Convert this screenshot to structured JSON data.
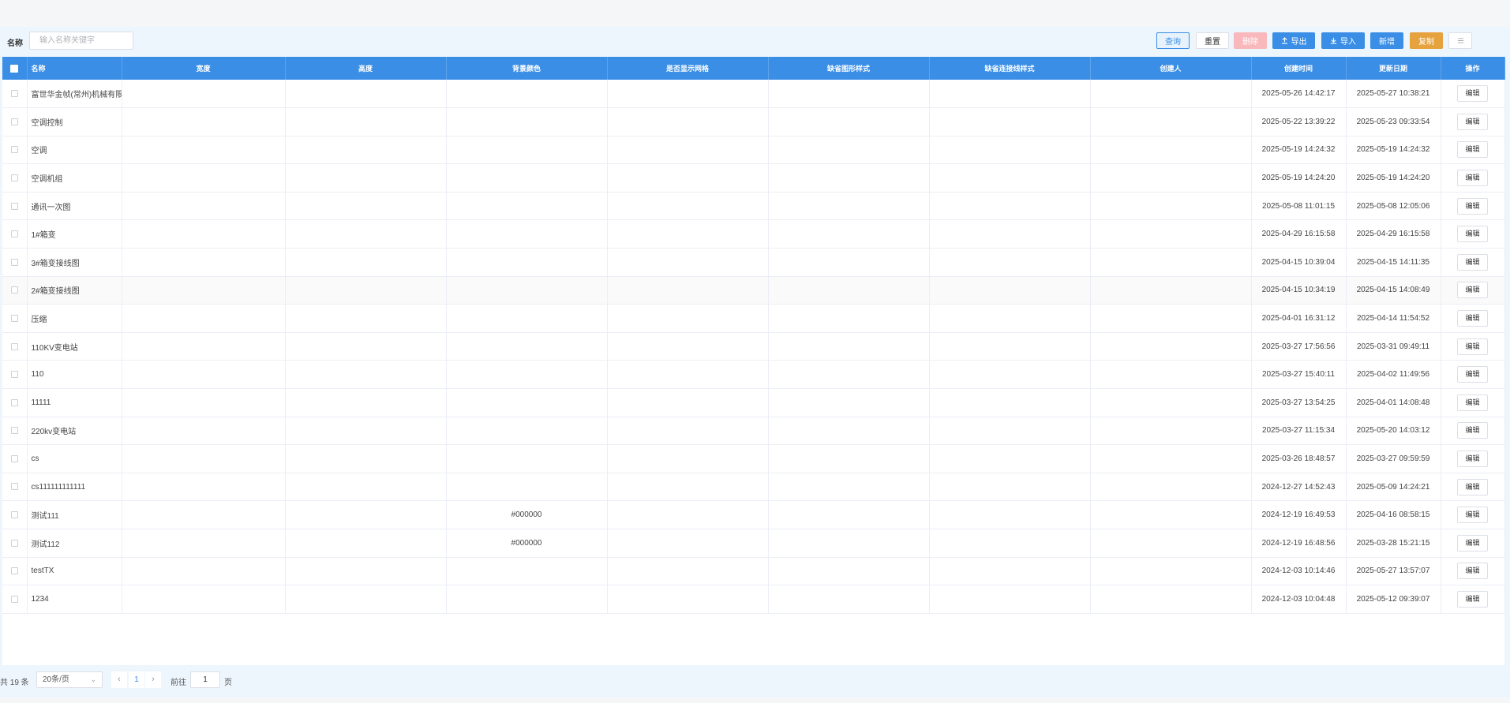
{
  "filter": {
    "label": "名称",
    "placeholder": "输入名称关键字",
    "value": ""
  },
  "toolbar": {
    "query": "查询",
    "reset": "重置",
    "delete": "删除",
    "export": "导出",
    "import": "导入",
    "add": "新增",
    "copy": "复制"
  },
  "icons": {
    "export": "upload-icon",
    "import": "download-icon",
    "columns": "columns-icon",
    "prev": "chevron-left-icon",
    "next": "chevron-right-icon",
    "select": "chevron-down-icon"
  },
  "colors": {
    "primary": "#3a8ee6",
    "danger_light": "#f8b8bc",
    "warning": "#e6a23c"
  },
  "table": {
    "columns": [
      "名称",
      "宽度",
      "高度",
      "背景颜色",
      "是否显示网格",
      "缺省图形样式",
      "缺省连接线样式",
      "创建人",
      "创建时间",
      "更新日期",
      "操作"
    ],
    "edit_label": "编辑",
    "rows": [
      {
        "name": "富世华金帧(常州)机械有限公",
        "bg": "",
        "created": "2025-05-26 14:42:17",
        "updated": "2025-05-27 10:38:21"
      },
      {
        "name": "空调控制",
        "bg": "",
        "created": "2025-05-22 13:39:22",
        "updated": "2025-05-23 09:33:54"
      },
      {
        "name": "空调",
        "bg": "",
        "created": "2025-05-19 14:24:32",
        "updated": "2025-05-19 14:24:32"
      },
      {
        "name": "空调机组",
        "bg": "",
        "created": "2025-05-19 14:24:20",
        "updated": "2025-05-19 14:24:20"
      },
      {
        "name": "通讯一次图",
        "bg": "",
        "created": "2025-05-08 11:01:15",
        "updated": "2025-05-08 12:05:06"
      },
      {
        "name": "1#箱变",
        "bg": "",
        "created": "2025-04-29 16:15:58",
        "updated": "2025-04-29 16:15:58"
      },
      {
        "name": "3#箱变接线图",
        "bg": "",
        "created": "2025-04-15 10:39:04",
        "updated": "2025-04-15 14:11:35"
      },
      {
        "name": "2#箱变接线图",
        "bg": "",
        "created": "2025-04-15 10:34:19",
        "updated": "2025-04-15 14:08:49"
      },
      {
        "name": "压缩",
        "bg": "",
        "created": "2025-04-01 16:31:12",
        "updated": "2025-04-14 11:54:52"
      },
      {
        "name": "110KV变电站",
        "bg": "",
        "created": "2025-03-27 17:56:56",
        "updated": "2025-03-31 09:49:11"
      },
      {
        "name": "110",
        "bg": "",
        "created": "2025-03-27 15:40:11",
        "updated": "2025-04-02 11:49:56"
      },
      {
        "name": "11111",
        "bg": "",
        "created": "2025-03-27 13:54:25",
        "updated": "2025-04-01 14:08:48"
      },
      {
        "name": "220kv变电站",
        "bg": "",
        "created": "2025-03-27 11:15:34",
        "updated": "2025-05-20 14:03:12"
      },
      {
        "name": "cs",
        "bg": "",
        "created": "2025-03-26 18:48:57",
        "updated": "2025-03-27 09:59:59"
      },
      {
        "name": "cs111111111111",
        "bg": "",
        "created": "2024-12-27 14:52:43",
        "updated": "2025-05-09 14:24:21"
      },
      {
        "name": "测试111",
        "bg": "#000000",
        "created": "2024-12-19 16:49:53",
        "updated": "2025-04-16 08:58:15"
      },
      {
        "name": "测试112",
        "bg": "#000000",
        "created": "2024-12-19 16:48:56",
        "updated": "2025-03-28 15:21:15"
      },
      {
        "name": "testTX",
        "bg": "",
        "created": "2024-12-03 10:14:46",
        "updated": "2025-05-27 13:57:07"
      },
      {
        "name": "1234",
        "bg": "",
        "created": "2024-12-03 10:04:48",
        "updated": "2025-05-12 09:39:07"
      }
    ]
  },
  "pagination": {
    "total_text": "共 19 条",
    "page_size": "20条/页",
    "current_page": "1",
    "goto_label": "前往",
    "goto_value": "1",
    "page_suffix": "页"
  }
}
